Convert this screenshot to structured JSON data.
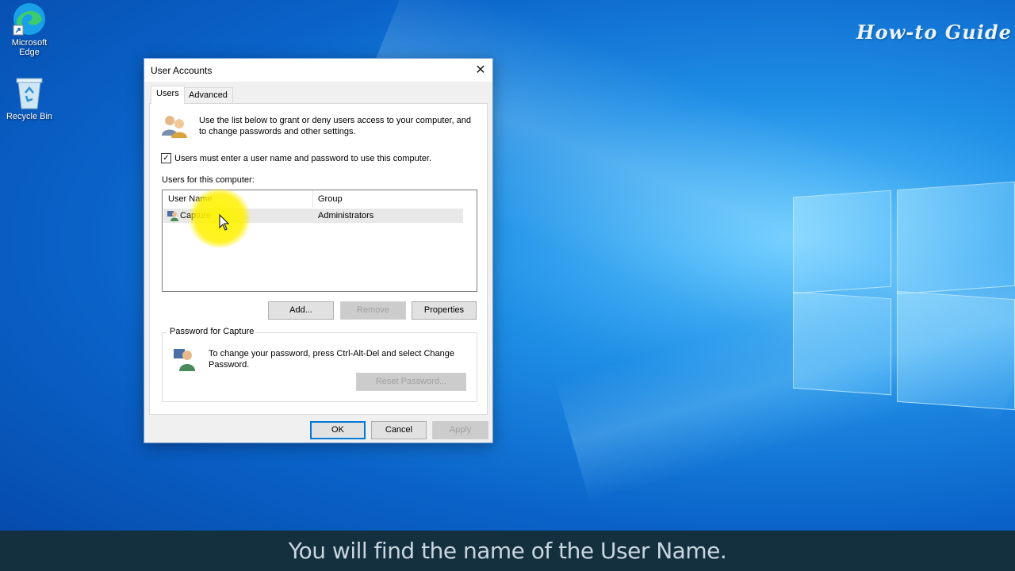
{
  "desktop": {
    "icons": [
      {
        "label_line1": "Microsoft",
        "label_line2": "Edge",
        "icon": "edge-icon"
      },
      {
        "label_line1": "Recycle Bin",
        "label_line2": "",
        "icon": "recycle-bin-icon"
      }
    ],
    "watermark": "How-to Guide",
    "caption": "You will find the name of the User Name."
  },
  "dialog": {
    "title": "User Accounts",
    "close_glyph": "✕",
    "tabs": [
      {
        "label": "Users",
        "active": true
      },
      {
        "label": "Advanced",
        "active": false
      }
    ],
    "intro_text": "Use the list below to grant or deny users access to your computer, and to change passwords and other settings.",
    "require_login_label": "Users must enter a user name and password to use this computer.",
    "require_login_checked": true,
    "users_label": "Users for this computer:",
    "columns": [
      "User Name",
      "Group"
    ],
    "rows": [
      {
        "user": "Capture",
        "group": "Administrators"
      }
    ],
    "buttons": {
      "add": "Add...",
      "remove": "Remove",
      "properties": "Properties",
      "reset_password": "Reset Password...",
      "ok": "OK",
      "cancel": "Cancel",
      "apply": "Apply"
    },
    "password_group_label": "Password for Capture",
    "password_text": "To change your password, press Ctrl-Alt-Del and select Change Password."
  },
  "colors": {
    "accent": "#0078d7",
    "caption_bg": "#14303f",
    "highlight": "#fff200"
  }
}
